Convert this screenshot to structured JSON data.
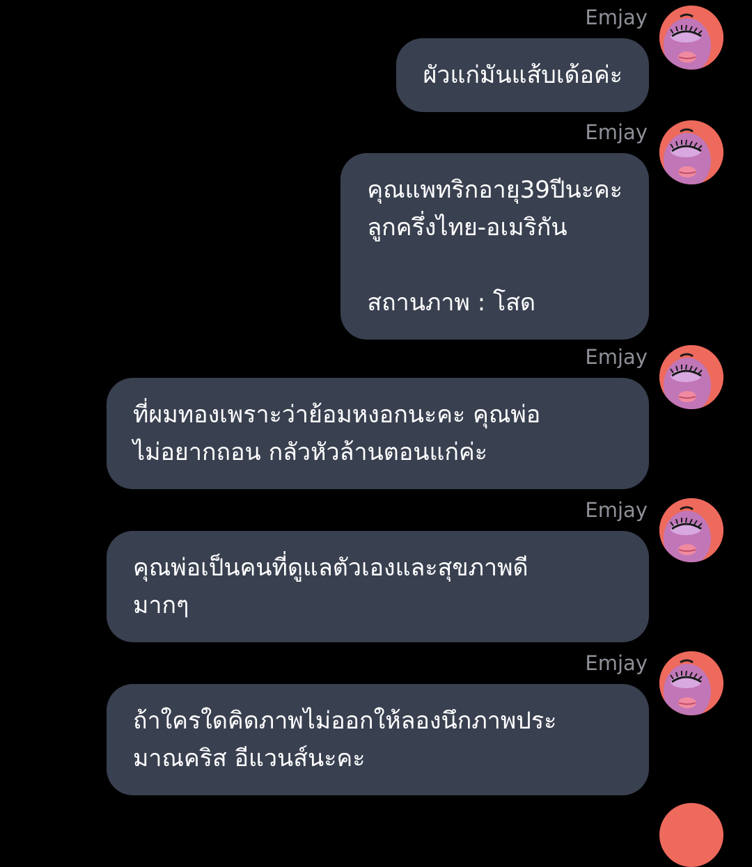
{
  "colors": {
    "background": "#000000",
    "bubble": "#394050",
    "bubble_text": "#ffffff",
    "sender_name": "#8e9098",
    "avatar_bg": "#ee6a5c",
    "avatar_face": "#b878c8"
  },
  "messages": [
    {
      "sender": "Emjay",
      "avatar_icon": "cartoon-face-avatar-icon",
      "lines": [
        "ผัวแก่มันแส้บเด้อค่ะ"
      ]
    },
    {
      "sender": "Emjay",
      "avatar_icon": "cartoon-face-avatar-icon",
      "lines": [
        "คุณแพทริกอายุ39ปีนะคะ",
        "ลูกครึ่งไทย-อเมริกัน",
        "",
        "สถานภาพ : โสด"
      ]
    },
    {
      "sender": "Emjay",
      "avatar_icon": "cartoon-face-avatar-icon",
      "lines": [
        "ที่ผมทองเพราะว่าย้อมหงอกนะคะ คุณพ่อ",
        "ไม่อยากถอน กลัวหัวล้านตอนแก่ค่ะ"
      ]
    },
    {
      "sender": "Emjay",
      "avatar_icon": "cartoon-face-avatar-icon",
      "lines": [
        "คุณพ่อเป็นคนที่ดูแลตัวเองและสุขภาพดี",
        "มากๆ"
      ]
    },
    {
      "sender": "Emjay",
      "avatar_icon": "cartoon-face-avatar-icon",
      "lines": [
        "ถ้าใครใดคิดภาพไม่ออกให้ลองนึกภาพประ",
        "มาณคริส อีแวนส์นะคะ"
      ]
    }
  ]
}
